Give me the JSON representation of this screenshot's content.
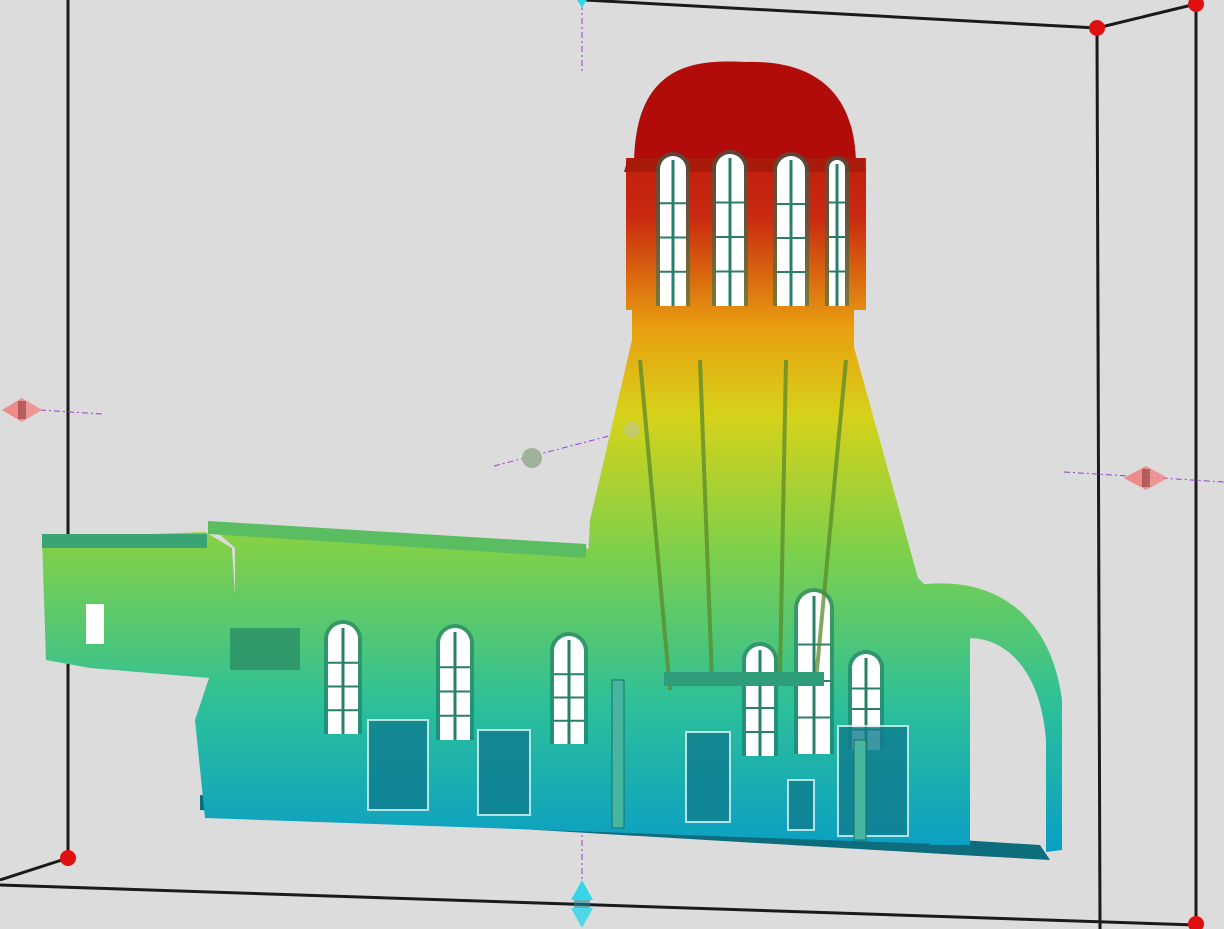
{
  "viewer": {
    "background_color": "#dcdcdc",
    "clip_box_edge_color": "#1a1a1a",
    "corner_handle_color": "#e01010",
    "x_handle_color": "#ef8a8a",
    "y_handle_color": "#35d6e6",
    "guide_line_color": "#9a3fd0",
    "pivot_color": "#9fb39a"
  },
  "point_cloud": {
    "subject": "church-nave-with-dome",
    "colormap": [
      "#0a9fc4",
      "#2bbf9a",
      "#7fd04a",
      "#d6d21a",
      "#e8a010",
      "#c92a10",
      "#b00a0a"
    ],
    "scalar_field": "height"
  }
}
